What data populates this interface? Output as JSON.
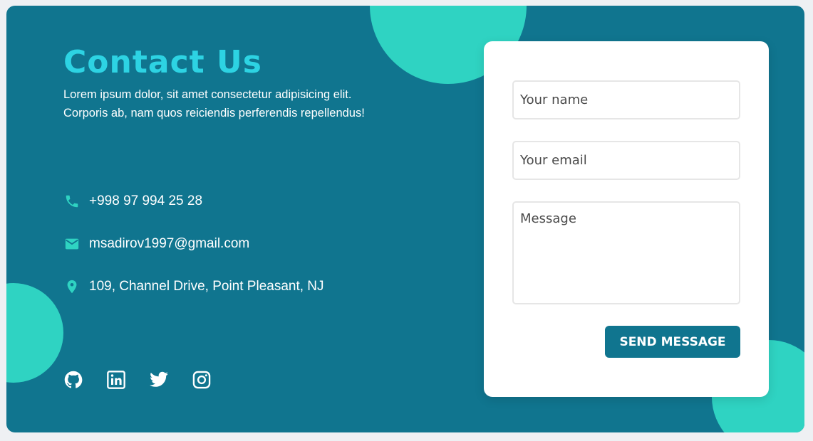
{
  "page": {
    "title": "Contact Us",
    "subtitle": "Lorem ipsum dolor, sit amet consectetur adipisicing elit. Corporis ab, nam quos reiciendis perferendis repellendus!"
  },
  "contact": {
    "phone": {
      "icon": "phone-icon",
      "text": "+998 97 994 25 28"
    },
    "email": {
      "icon": "mail-icon",
      "text": "msadirov1997@gmail.com"
    },
    "address": {
      "icon": "map-pin-icon",
      "text": "109, Channel Drive, Point Pleasant, NJ"
    }
  },
  "socials": [
    {
      "icon": "github-icon"
    },
    {
      "icon": "linkedin-icon"
    },
    {
      "icon": "twitter-icon"
    },
    {
      "icon": "instagram-icon"
    }
  ],
  "form": {
    "name": {
      "value": "",
      "placeholder": "Your name"
    },
    "email": {
      "value": "",
      "placeholder": "Your email"
    },
    "message": {
      "value": "",
      "placeholder": "Message"
    },
    "submit_label": "SEND MESSAGE"
  },
  "colors": {
    "background": "#10758f",
    "accent": "#2fd3c2",
    "title": "#2dd3e3",
    "button": "#10758f",
    "card": "#ffffff"
  }
}
